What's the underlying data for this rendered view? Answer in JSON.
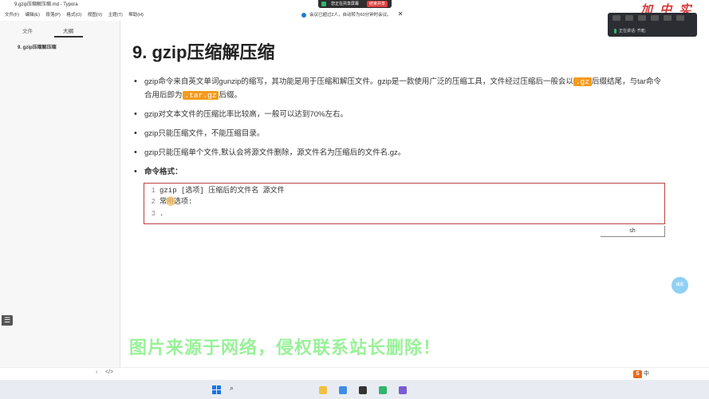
{
  "window": {
    "title": "9.gzip压缩解压缩.md - Typora"
  },
  "menu": [
    "文件(F)",
    "编辑(E)",
    "段落(P)",
    "格式(O)",
    "视图(V)",
    "主题(T)",
    "帮助(H)"
  ],
  "share_bar": {
    "text": "您正在共享屏幕",
    "stop_label": "结束共享"
  },
  "notice": {
    "text": "会议已超过2人，自动转为60分钟时会议。",
    "close": "✕"
  },
  "logo_text": "加中实训",
  "meeting": {
    "speaker_label": "正在讲话:",
    "speaker_name": "齐乾;"
  },
  "sidebar": {
    "tab_files": "文件",
    "tab_outline": "大纲",
    "outline_items": [
      "9. gzip压缩解压缩"
    ]
  },
  "doc": {
    "heading": "9. gzip压缩解压缩",
    "bullet1_a": "gzip命令来自英文单词gunzip的缩写，其功能是用于压缩和解压文件。gzip是一款使用广泛的压缩工具，文件经过压缩后一般会以",
    "bullet1_code1": ".gz",
    "bullet1_b": "后缀结尾，与tar命令合用后即为",
    "bullet1_code2": ".tar.gz",
    "bullet1_c": "后缀。",
    "bullet2": "gzip对文本文件的压缩比率比较高，一般可以达到70%左右。",
    "bullet3": "gzip只能压缩文件，不能压缩目录。",
    "bullet4": "gzip只能压缩单个文件,默认会将源文件删除，源文件名为压缩后的文件名.gz。",
    "bullet5": "命令格式："
  },
  "codeblock": {
    "lines": [
      {
        "num": "1",
        "text": "gzip [选项] 压缩后的文件名 源文件"
      },
      {
        "num": "2",
        "text": "常用选项:"
      },
      {
        "num": "3",
        "text": "."
      }
    ],
    "language": "sh"
  },
  "float_button": "辅助",
  "watermark": "图片来源于网络，侵权联系站长删除！",
  "statusbar": {
    "back": "‹",
    "code": "</>"
  },
  "ime": {
    "logo": "S",
    "lang": "中"
  },
  "taskbar": {
    "search_glyph": "⌕"
  }
}
